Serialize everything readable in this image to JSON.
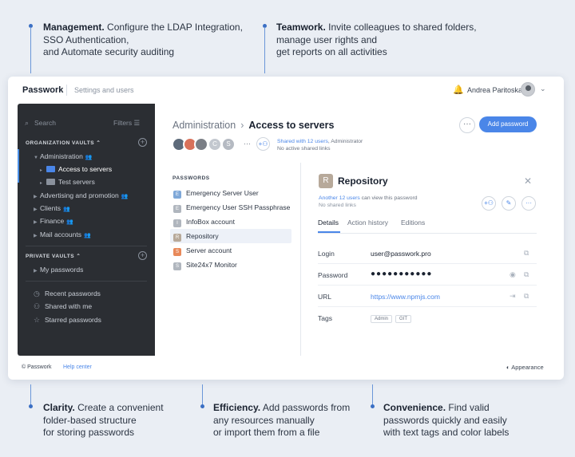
{
  "callouts_top": [
    {
      "title": "Management.",
      "lines": [
        " Configure the LDAP Integration,",
        "SSO Authentication,",
        "and Automate security auditing"
      ]
    },
    {
      "title": "Teamwork.",
      "lines": [
        " Invite colleagues to shared folders,",
        "manage user rights and",
        "get reports on all activities"
      ]
    }
  ],
  "callouts_bottom": [
    {
      "title": "Clarity.",
      "lines": [
        " Create a convenient",
        "folder-based structure",
        "for storing passwords"
      ]
    },
    {
      "title": "Efficiency.",
      "lines": [
        " Add passwords from",
        "any resources manually",
        "or import them from a file"
      ]
    },
    {
      "title": "Convenience.",
      "lines": [
        " Find valid",
        "passwords quickly and easily",
        "with text tags and color labels"
      ]
    }
  ],
  "topbar": {
    "brand": "Passwork",
    "subtitle": "Settings and users",
    "user_name": "Andrea Paritoska"
  },
  "sidebar": {
    "search_placeholder": "Search",
    "filters_label": "Filters",
    "org_section": "ORGANIZATION VAULTS",
    "org_items": [
      {
        "label": "Administration",
        "level": 0
      },
      {
        "label": "Access to servers",
        "level": 1,
        "active": true
      },
      {
        "label": "Test servers",
        "level": 1
      },
      {
        "label": "Advertising and promotion",
        "level": 0
      },
      {
        "label": "Clients",
        "level": 0
      },
      {
        "label": "Finance",
        "level": 0
      },
      {
        "label": "Mail accounts",
        "level": 0
      }
    ],
    "private_section": "PRIVATE VAULTS",
    "private_items": [
      {
        "label": "My passwords"
      }
    ],
    "bottom_items": [
      {
        "label": "Recent passwords",
        "icon": "clock-icon"
      },
      {
        "label": "Shared with me",
        "icon": "users-icon"
      },
      {
        "label": "Starred passwords",
        "icon": "star-icon"
      }
    ]
  },
  "header": {
    "breadcrumb_parent": "Administration",
    "breadcrumb_current": "Access to servers",
    "add_button": "Add password",
    "share_line1_link": "Shared with 12 users",
    "share_line1_rest": ", Administrator",
    "share_line2": "No active shared links",
    "share_avatars": [
      "",
      "",
      "",
      "C",
      "S"
    ]
  },
  "passwords": {
    "heading": "PASSWORDS",
    "items": [
      {
        "label": "Emergency Server User",
        "badge": "E",
        "color": "#7fa8d8"
      },
      {
        "label": "Emergency User SSH Passphrase",
        "badge": "E",
        "color": "#b0b6be"
      },
      {
        "label": "InfoBox account",
        "badge": "I",
        "color": "#b0b6be"
      },
      {
        "label": "Repository",
        "badge": "R",
        "color": "#b7a99a",
        "active": true
      },
      {
        "label": "Server account",
        "badge": "S",
        "color": "#e8895a"
      },
      {
        "label": "Site24x7 Monitor",
        "badge": "S",
        "color": "#b0b6be"
      }
    ]
  },
  "detail": {
    "badge": "R",
    "title": "Repository",
    "sub1_link": "Another 12 users",
    "sub1_rest": " can view this password",
    "sub2": "No shared links",
    "tabs": [
      "Details",
      "Action history",
      "Editions"
    ],
    "fields": [
      {
        "label": "Login",
        "value": "user@passwork.pro"
      },
      {
        "label": "Password",
        "value": "●●●●●●●●●●●"
      },
      {
        "label": "URL",
        "value": "https://www.npmjs.com"
      },
      {
        "label": "Tags",
        "tags": [
          "Admin",
          "GIT"
        ]
      }
    ]
  },
  "footer": {
    "copyright": "© Passwork",
    "help": "Help center",
    "appearance": "Appearance"
  }
}
